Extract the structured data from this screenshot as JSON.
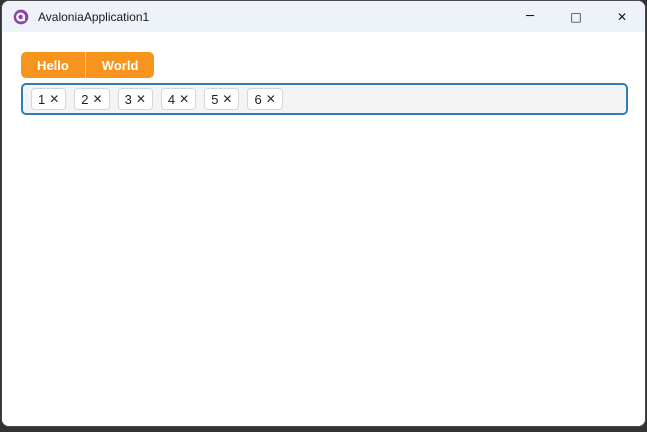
{
  "colors": {
    "accent_orange": "#F7941E",
    "focus_border_blue": "#2E7DB5",
    "titlebar_bg": "#EEF2F9",
    "chipbar_bg": "#F4F4F4"
  },
  "window": {
    "title": "AvaloniaApplication1",
    "controls": {
      "minimize_glyph": "─",
      "maximize_glyph": "□",
      "close_glyph": "✕"
    }
  },
  "tabstrip": {
    "tabs": [
      {
        "label": "Hello"
      },
      {
        "label": "World"
      }
    ]
  },
  "chip_bar": {
    "remove_glyph": "✕",
    "chips": [
      "1",
      "2",
      "3",
      "4",
      "5",
      "6"
    ]
  }
}
